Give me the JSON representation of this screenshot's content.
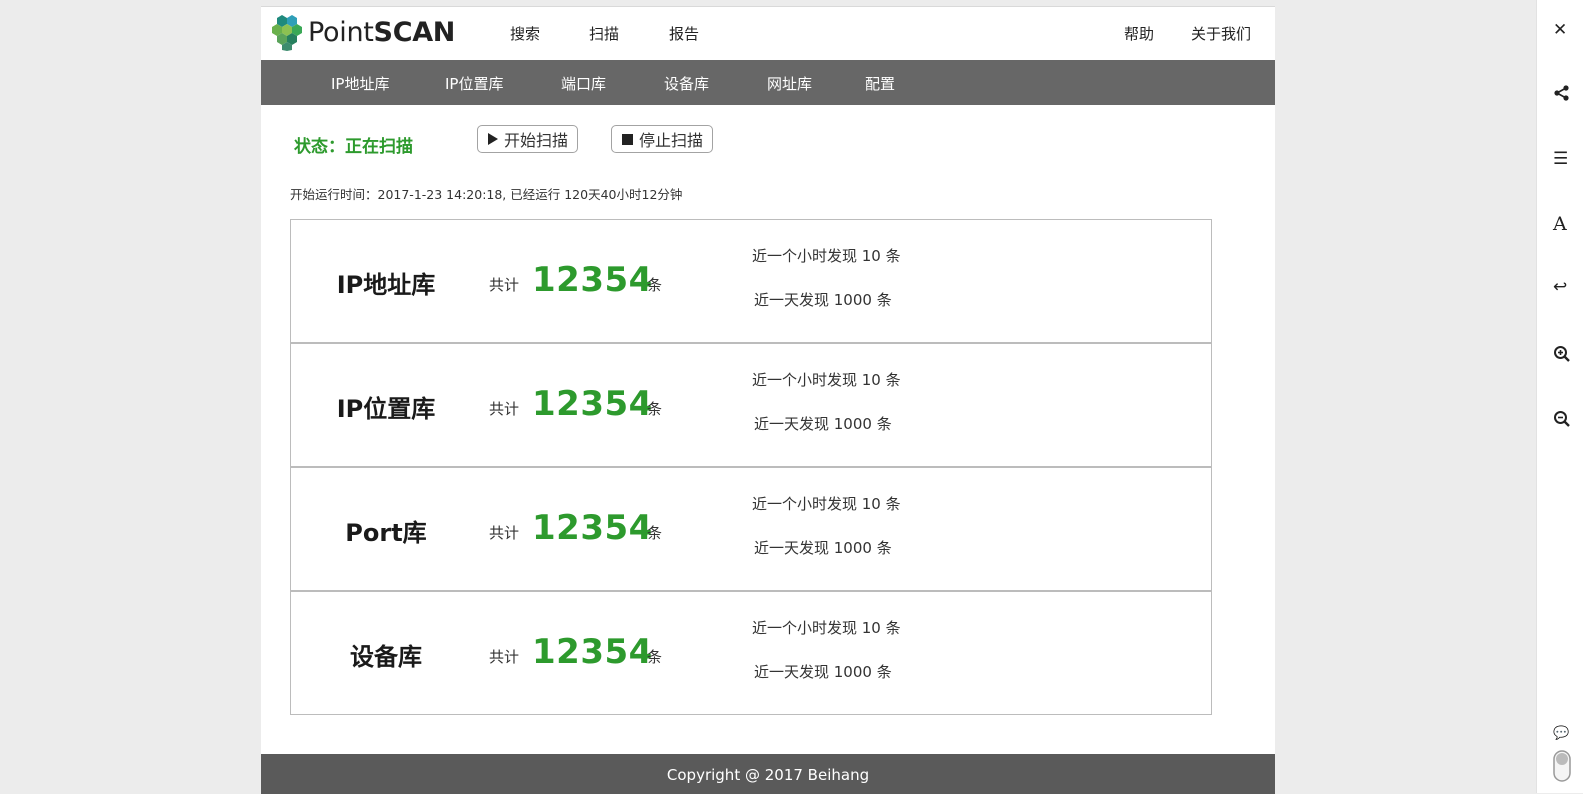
{
  "brand": {
    "logo_prefix": "Point",
    "logo_suffix": "SCAN"
  },
  "top_nav": [
    "搜索",
    "扫描",
    "报告"
  ],
  "top_right": {
    "help": "帮助",
    "about": "关于我们"
  },
  "menu": [
    "IP地址库",
    "IP位置库",
    "端口库",
    "设备库",
    "网址库",
    "配置"
  ],
  "status": {
    "text": "状态：正在扫描"
  },
  "buttons": {
    "start": "开始扫描",
    "stop": "停止扫描"
  },
  "runtime": "开始运行时间：2017-1-23 14:20:18, 已经运行 120天40小时12分钟",
  "stats": [
    {
      "name": "IP地址库",
      "total_label": "共计",
      "count": "12354",
      "unit": "条",
      "last_hour": "近一个小时发现 10 条",
      "last_day": "近一天发现 1000 条"
    },
    {
      "name": "IP位置库",
      "total_label": "共计",
      "count": "12354",
      "unit": "条",
      "last_hour": "近一个小时发现 10 条",
      "last_day": "近一天发现 1000 条"
    },
    {
      "name": "Port库",
      "total_label": "共计",
      "count": "12354",
      "unit": "条",
      "last_hour": "近一个小时发现 10 条",
      "last_day": "近一天发现 1000 条"
    },
    {
      "name": "设备库",
      "total_label": "共计",
      "count": "12354",
      "unit": "条",
      "last_hour": "近一个小时发现 10 条",
      "last_day": "近一天发现 1000 条"
    }
  ],
  "footer": {
    "copyright": "Copyright @ 2017 Beihang"
  },
  "sidebar_icons": [
    "close-icon",
    "share-icon",
    "menu-icon",
    "font-size-icon",
    "reply-icon",
    "zoom-in-icon",
    "zoom-out-icon",
    "comment-icon",
    "toggle-icon"
  ],
  "colors": {
    "accent_green": "#2d9a2d",
    "menu_bar": "#676767",
    "footer": "#5a5a5a"
  }
}
